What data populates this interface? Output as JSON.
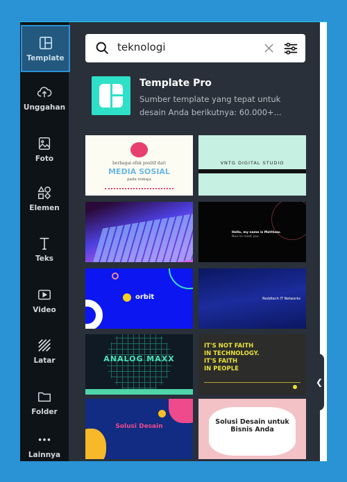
{
  "sidebar": {
    "items": [
      {
        "label": "Template",
        "icon": "template-icon",
        "active": true
      },
      {
        "label": "Unggahan",
        "icon": "upload-cloud-icon"
      },
      {
        "label": "Foto",
        "icon": "photo-icon"
      },
      {
        "label": "Elemen",
        "icon": "shapes-icon"
      },
      {
        "label": "Teks",
        "icon": "text-icon"
      },
      {
        "label": "Video",
        "icon": "video-icon"
      },
      {
        "label": "Latar",
        "icon": "background-icon"
      },
      {
        "label": "Folder",
        "icon": "folder-icon"
      },
      {
        "label": "Lainnya",
        "icon": "more-icon"
      }
    ]
  },
  "search": {
    "value": "teknologi"
  },
  "promo": {
    "title": "Template Pro",
    "description": "Sumber template yang tepat untuk desain Anda berikutnya: 60.000+...",
    "accent": "#2ee0c8"
  },
  "templates": [
    {
      "lines": [
        "berbagai efek positif dari",
        "MEDIA SOSIAL",
        "pada remaja"
      ]
    },
    {
      "lines": [
        "VNTG DIGITAL STUDIO"
      ]
    },
    {
      "lines": []
    },
    {
      "lines": [
        "Hello, my name is Matthew.",
        "Nice to meet you."
      ]
    },
    {
      "lines": [
        "orbit"
      ]
    },
    {
      "lines": [
        "Reddtech IT Networks"
      ]
    },
    {
      "lines": [
        "ANALOG MAXX"
      ]
    },
    {
      "lines": [
        "IT'S NOT FAITH",
        "IN TECHNOLOGY.",
        "IT'S FAITH",
        "IN PEOPLE"
      ]
    },
    {
      "lines": [
        "Solusi Desain"
      ]
    },
    {
      "lines": [
        "Solusi Desain untuk",
        "Bisnis Anda"
      ]
    }
  ],
  "colors": {
    "background": "#2a93d6",
    "sidebar": "#0e1318",
    "panel": "#293039",
    "active": "#23587f"
  }
}
